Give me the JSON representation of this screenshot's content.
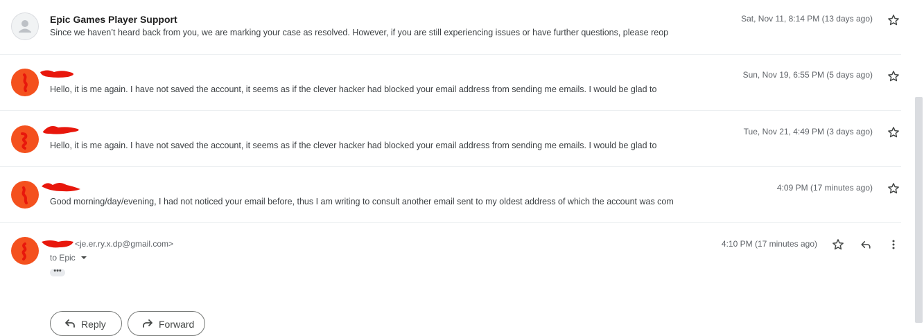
{
  "messages": [
    {
      "sender": "Epic Games Player Support",
      "snippet": "Since we haven’t heard back from you, we are marking your case as resolved. However, if you are still experiencing issues or have further questions, please reop",
      "date": "Sat, Nov 11, 8:14 PM (13 days ago)",
      "avatar_icon": "person-icon"
    },
    {
      "sender": "",
      "snippet": "Hello, it is me again. I have not saved the account, it seems as if the clever hacker had blocked your email address from sending me emails. I would be glad to",
      "date": "Sun, Nov 19, 6:55 PM (5 days ago)"
    },
    {
      "sender": "",
      "snippet": "Hello, it is me again. I have not saved the account, it seems as if the clever hacker had blocked your email address from sending me emails. I would be glad to",
      "date": "Tue, Nov 21, 4:49 PM (3 days ago)"
    },
    {
      "sender": "",
      "snippet": "Good morning/day/evening, I had not noticed your email before, thus I am writing to consult another email sent to my oldest address of which the account was com",
      "date": "4:09 PM (17 minutes ago)"
    }
  ],
  "open_message": {
    "sender_email": "<je.er.ry.x.dp@gmail.com>",
    "recipient": "to Epic",
    "date": "4:10 PM (17 minutes ago)",
    "ellipsis": "•••"
  },
  "actions": {
    "reply_label": "Reply",
    "forward_label": "Forward"
  },
  "colors": {
    "avatar_orange": "#f4511e",
    "redaction_red": "#e8170c",
    "star_grey": "#444746"
  }
}
